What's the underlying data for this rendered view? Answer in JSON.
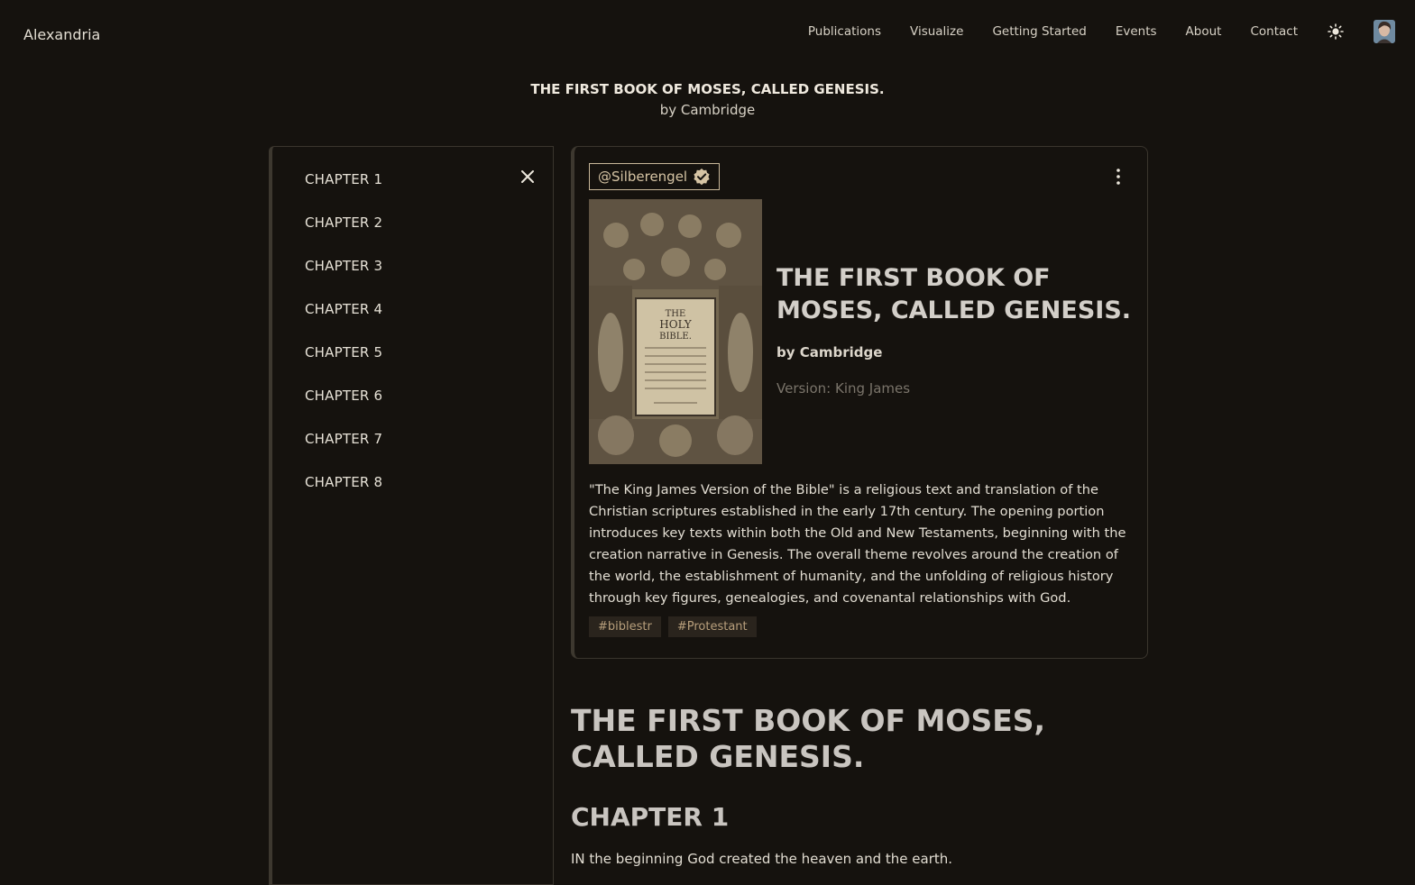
{
  "app": {
    "brand": "Alexandria"
  },
  "nav": {
    "items": [
      "Publications",
      "Visualize",
      "Getting Started",
      "Events",
      "About",
      "Contact"
    ],
    "theme_icon": "sun-icon",
    "avatar_icon": "user-avatar"
  },
  "publication": {
    "title": "THE FIRST BOOK OF MOSES, CALLED GENESIS.",
    "author_line": "by Cambridge"
  },
  "toc": {
    "close_icon": "close-icon",
    "chapters": [
      "CHAPTER 1",
      "CHAPTER 2",
      "CHAPTER 3",
      "CHAPTER 4",
      "CHAPTER 5",
      "CHAPTER 6",
      "CHAPTER 7",
      "CHAPTER 8"
    ]
  },
  "card": {
    "author_handle": "@Silberengel",
    "verified_icon": "verified-check-icon",
    "more_icon": "more-vertical-icon",
    "cover": {
      "line1": "THE",
      "line2": "HOLY",
      "line3": "BIBLE."
    },
    "title": "THE FIRST BOOK OF MOSES, CALLED GENESIS.",
    "author": "by Cambridge",
    "version": "Version: King James",
    "description": "\"The King James Version of the Bible\" is a religious text and translation of the Christian scriptures established in the early 17th century. The opening portion introduces key texts within both the Old and New Testaments, beginning with the creation narrative in Genesis. The overall theme revolves around the creation of the world, the establishment of humanity, and the unfolding of religious history through key figures, genealogies, and covenantal relationships with God.",
    "tags": [
      "#biblestr",
      "#Protestant"
    ]
  },
  "content": {
    "title": "THE FIRST BOOK OF MOSES, CALLED GENESIS.",
    "chapter_heading": "CHAPTER 1",
    "first_verse": "IN the beginning God created the heaven and the earth."
  },
  "colors": {
    "background": "#15120e",
    "accent": "#c9b89a",
    "tag_text": "#b89f7c"
  }
}
